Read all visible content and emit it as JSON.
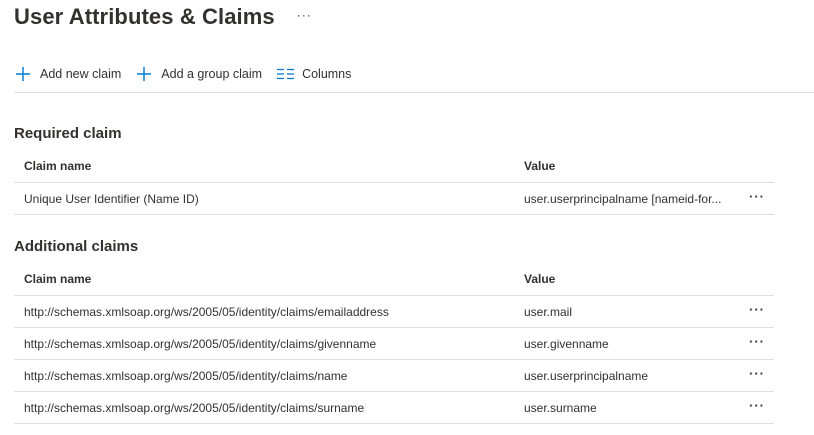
{
  "page": {
    "title": "User Attributes & Claims",
    "more_label": "···"
  },
  "toolbar": {
    "add_claim": {
      "label": "Add new claim",
      "icon": "plus-icon"
    },
    "add_group_claim": {
      "label": "Add a group claim",
      "icon": "plus-icon"
    },
    "columns": {
      "label": "Columns",
      "icon": "columns-icon"
    },
    "accent_color": "#0078d4"
  },
  "required": {
    "title": "Required claim",
    "columns": {
      "name": "Claim name",
      "value": "Value"
    },
    "rows": [
      {
        "name": "Unique User Identifier (Name ID)",
        "value": "user.userprincipalname [nameid-for...",
        "more": "···"
      }
    ]
  },
  "additional": {
    "title": "Additional claims",
    "columns": {
      "name": "Claim name",
      "value": "Value"
    },
    "rows": [
      {
        "name": "http://schemas.xmlsoap.org/ws/2005/05/identity/claims/emailaddress",
        "value": "user.mail",
        "more": "···"
      },
      {
        "name": "http://schemas.xmlsoap.org/ws/2005/05/identity/claims/givenname",
        "value": "user.givenname",
        "more": "···"
      },
      {
        "name": "http://schemas.xmlsoap.org/ws/2005/05/identity/claims/name",
        "value": "user.userprincipalname",
        "more": "···"
      },
      {
        "name": "http://schemas.xmlsoap.org/ws/2005/05/identity/claims/surname",
        "value": "user.surname",
        "more": "···"
      }
    ]
  }
}
